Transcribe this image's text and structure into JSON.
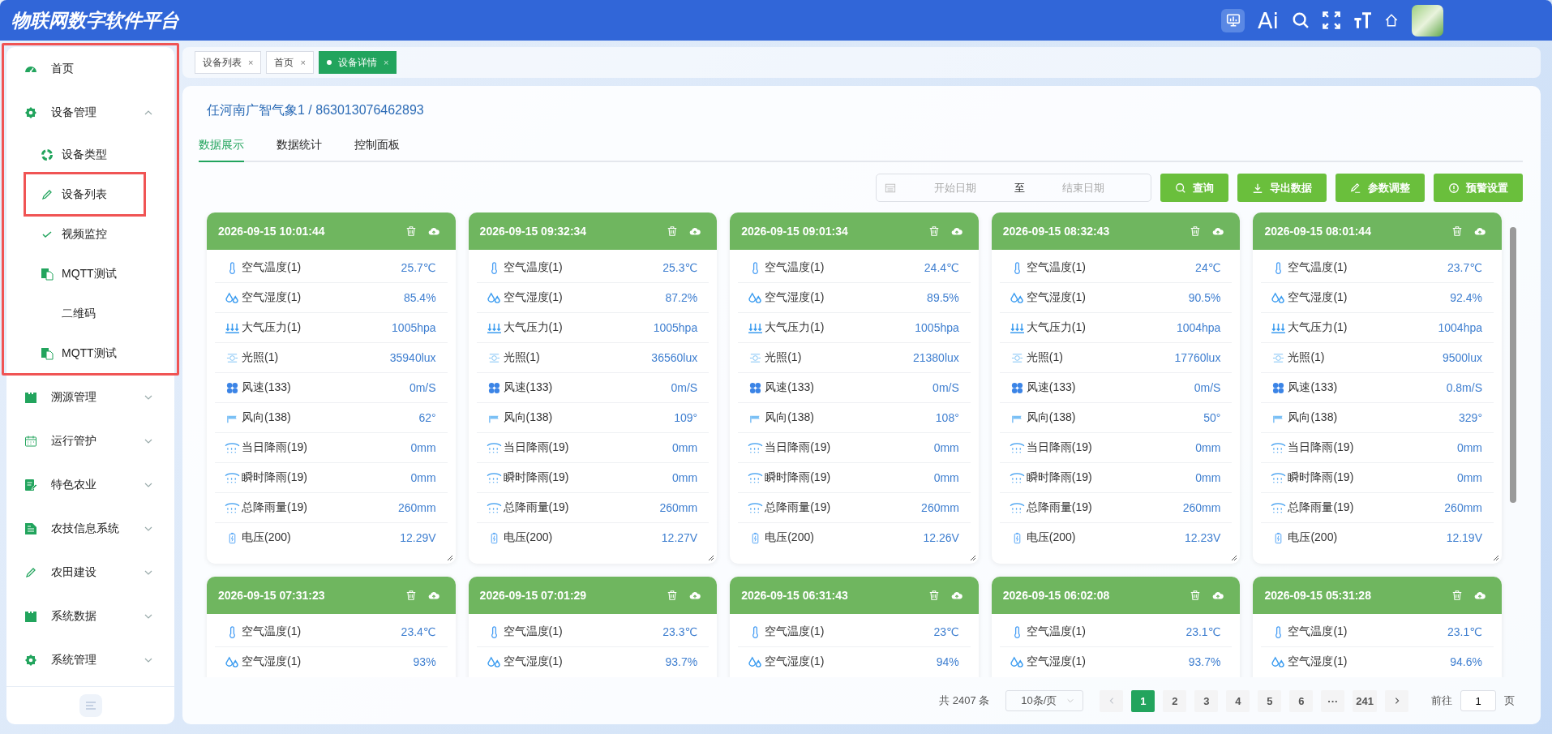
{
  "app": {
    "title": "物联网数字软件平台",
    "ai_label": "Ai"
  },
  "sidebar": {
    "sections": [
      {
        "outlined": true,
        "items": [
          {
            "kind": "gauge",
            "label": "首页",
            "has_children": false
          },
          {
            "kind": "gear",
            "label": "设备管理",
            "expanded": true,
            "has_children": true,
            "children": [
              {
                "kind": "ring",
                "label": "设备类型",
                "outlined": false
              },
              {
                "kind": "pencil",
                "label": "设备列表",
                "outlined": true
              },
              {
                "kind": "check",
                "label": "视频监控",
                "outlined": false
              },
              {
                "kind": "docs",
                "label": "MQTT测试",
                "outlined": false
              },
              {
                "kind": "none",
                "label": "二维码",
                "outlined": false
              },
              {
                "kind": "docs",
                "label": "MQTT测试",
                "outlined": false
              }
            ]
          }
        ]
      },
      {
        "items": [
          {
            "kind": "folder",
            "label": "溯源管理",
            "expanded": false,
            "has_children": true
          },
          {
            "kind": "calendar",
            "label": "运行管护",
            "expanded": false,
            "has_children": true
          },
          {
            "kind": "note",
            "label": "特色农业",
            "expanded": false,
            "has_children": true
          },
          {
            "kind": "doc",
            "label": "农技信息系统",
            "expanded": false,
            "has_children": true
          },
          {
            "kind": "pencil",
            "label": "农田建设",
            "expanded": false,
            "has_children": true
          },
          {
            "kind": "folder",
            "label": "系统数据",
            "expanded": false,
            "has_children": true
          },
          {
            "kind": "gear",
            "label": "系统管理",
            "expanded": false,
            "has_children": true
          }
        ]
      }
    ]
  },
  "tabs": [
    {
      "label": "设备列表",
      "selected": false,
      "close": "×"
    },
    {
      "label": "首页",
      "selected": false,
      "close": "×"
    },
    {
      "label": "设备详情",
      "selected": true,
      "close": "×"
    }
  ],
  "device": {
    "title": "任河南广智气象1 / 863013076462893"
  },
  "subtabs": [
    {
      "label": "数据展示",
      "selected": true
    },
    {
      "label": "数据统计",
      "selected": false
    },
    {
      "label": "控制面板",
      "selected": false
    }
  ],
  "filter": {
    "start_placeholder": "开始日期",
    "separator": "至",
    "end_placeholder": "结束日期"
  },
  "actions": [
    {
      "kind": "search",
      "label": "查询"
    },
    {
      "kind": "download",
      "label": "导出数据"
    },
    {
      "kind": "edit",
      "label": "参数调整"
    },
    {
      "kind": "alert",
      "label": "预警设置"
    }
  ],
  "records": [
    {
      "time": "2026-09-15 10:01:44",
      "readings": [
        {
          "kind": "temp",
          "label": "空气温度(1)",
          "value": "25.7℃"
        },
        {
          "kind": "humid",
          "label": "空气湿度(1)",
          "value": "85.4%"
        },
        {
          "kind": "pressure",
          "label": "大气压力(1)",
          "value": "1005hpa"
        },
        {
          "kind": "light",
          "label": "光照(1)",
          "value": "35940lux"
        },
        {
          "kind": "wind",
          "label": "风速(133)",
          "value": "0m/S"
        },
        {
          "kind": "flag",
          "label": "风向(138)",
          "value": "62°"
        },
        {
          "kind": "rain",
          "label": "当日降雨(19)",
          "value": "0mm"
        },
        {
          "kind": "rain",
          "label": "瞬时降雨(19)",
          "value": "0mm"
        },
        {
          "kind": "rain",
          "label": "总降雨量(19)",
          "value": "260mm"
        },
        {
          "kind": "battery",
          "label": "电压(200)",
          "value": "12.29V"
        }
      ]
    },
    {
      "time": "2026-09-15 09:32:34",
      "readings": [
        {
          "kind": "temp",
          "label": "空气温度(1)",
          "value": "25.3℃"
        },
        {
          "kind": "humid",
          "label": "空气湿度(1)",
          "value": "87.2%"
        },
        {
          "kind": "pressure",
          "label": "大气压力(1)",
          "value": "1005hpa"
        },
        {
          "kind": "light",
          "label": "光照(1)",
          "value": "36560lux"
        },
        {
          "kind": "wind",
          "label": "风速(133)",
          "value": "0m/S"
        },
        {
          "kind": "flag",
          "label": "风向(138)",
          "value": "109°"
        },
        {
          "kind": "rain",
          "label": "当日降雨(19)",
          "value": "0mm"
        },
        {
          "kind": "rain",
          "label": "瞬时降雨(19)",
          "value": "0mm"
        },
        {
          "kind": "rain",
          "label": "总降雨量(19)",
          "value": "260mm"
        },
        {
          "kind": "battery",
          "label": "电压(200)",
          "value": "12.27V"
        }
      ]
    },
    {
      "time": "2026-09-15 09:01:34",
      "readings": [
        {
          "kind": "temp",
          "label": "空气温度(1)",
          "value": "24.4℃"
        },
        {
          "kind": "humid",
          "label": "空气湿度(1)",
          "value": "89.5%"
        },
        {
          "kind": "pressure",
          "label": "大气压力(1)",
          "value": "1005hpa"
        },
        {
          "kind": "light",
          "label": "光照(1)",
          "value": "21380lux"
        },
        {
          "kind": "wind",
          "label": "风速(133)",
          "value": "0m/S"
        },
        {
          "kind": "flag",
          "label": "风向(138)",
          "value": "108°"
        },
        {
          "kind": "rain",
          "label": "当日降雨(19)",
          "value": "0mm"
        },
        {
          "kind": "rain",
          "label": "瞬时降雨(19)",
          "value": "0mm"
        },
        {
          "kind": "rain",
          "label": "总降雨量(19)",
          "value": "260mm"
        },
        {
          "kind": "battery",
          "label": "电压(200)",
          "value": "12.26V"
        }
      ]
    },
    {
      "time": "2026-09-15 08:32:43",
      "readings": [
        {
          "kind": "temp",
          "label": "空气温度(1)",
          "value": "24℃"
        },
        {
          "kind": "humid",
          "label": "空气湿度(1)",
          "value": "90.5%"
        },
        {
          "kind": "pressure",
          "label": "大气压力(1)",
          "value": "1004hpa"
        },
        {
          "kind": "light",
          "label": "光照(1)",
          "value": "17760lux"
        },
        {
          "kind": "wind",
          "label": "风速(133)",
          "value": "0m/S"
        },
        {
          "kind": "flag",
          "label": "风向(138)",
          "value": "50°"
        },
        {
          "kind": "rain",
          "label": "当日降雨(19)",
          "value": "0mm"
        },
        {
          "kind": "rain",
          "label": "瞬时降雨(19)",
          "value": "0mm"
        },
        {
          "kind": "rain",
          "label": "总降雨量(19)",
          "value": "260mm"
        },
        {
          "kind": "battery",
          "label": "电压(200)",
          "value": "12.23V"
        }
      ]
    },
    {
      "time": "2026-09-15 08:01:44",
      "readings": [
        {
          "kind": "temp",
          "label": "空气温度(1)",
          "value": "23.7℃"
        },
        {
          "kind": "humid",
          "label": "空气湿度(1)",
          "value": "92.4%"
        },
        {
          "kind": "pressure",
          "label": "大气压力(1)",
          "value": "1004hpa"
        },
        {
          "kind": "light",
          "label": "光照(1)",
          "value": "9500lux"
        },
        {
          "kind": "wind",
          "label": "风速(133)",
          "value": "0.8m/S"
        },
        {
          "kind": "flag",
          "label": "风向(138)",
          "value": "329°"
        },
        {
          "kind": "rain",
          "label": "当日降雨(19)",
          "value": "0mm"
        },
        {
          "kind": "rain",
          "label": "瞬时降雨(19)",
          "value": "0mm"
        },
        {
          "kind": "rain",
          "label": "总降雨量(19)",
          "value": "260mm"
        },
        {
          "kind": "battery",
          "label": "电压(200)",
          "value": "12.19V"
        }
      ]
    },
    {
      "time": "2026-09-15 07:31:23",
      "readings": [
        {
          "kind": "temp",
          "label": "空气温度(1)",
          "value": "23.4℃"
        },
        {
          "kind": "humid",
          "label": "空气湿度(1)",
          "value": "93%"
        }
      ]
    },
    {
      "time": "2026-09-15 07:01:29",
      "readings": [
        {
          "kind": "temp",
          "label": "空气温度(1)",
          "value": "23.3℃"
        },
        {
          "kind": "humid",
          "label": "空气湿度(1)",
          "value": "93.7%"
        }
      ]
    },
    {
      "time": "2026-09-15 06:31:43",
      "readings": [
        {
          "kind": "temp",
          "label": "空气温度(1)",
          "value": "23℃"
        },
        {
          "kind": "humid",
          "label": "空气湿度(1)",
          "value": "94%"
        }
      ]
    },
    {
      "time": "2026-09-15 06:02:08",
      "readings": [
        {
          "kind": "temp",
          "label": "空气温度(1)",
          "value": "23.1℃"
        },
        {
          "kind": "humid",
          "label": "空气湿度(1)",
          "value": "93.7%"
        }
      ]
    },
    {
      "time": "2026-09-15 05:31:28",
      "readings": [
        {
          "kind": "temp",
          "label": "空气温度(1)",
          "value": "23.1℃"
        },
        {
          "kind": "humid",
          "label": "空气湿度(1)",
          "value": "94.6%"
        }
      ]
    }
  ],
  "pagination": {
    "total": "共 2407 条",
    "page_size": "10条/页",
    "prev_disabled": true,
    "pages": [
      {
        "label": "1",
        "selected": true
      },
      {
        "label": "2",
        "selected": false
      },
      {
        "label": "3",
        "selected": false
      },
      {
        "label": "4",
        "selected": false
      },
      {
        "label": "5",
        "selected": false
      },
      {
        "label": "6",
        "selected": false
      },
      {
        "label": "···",
        "selected": false
      },
      {
        "label": "241",
        "selected": false
      }
    ],
    "goto_label": "前往",
    "goto_value": "1",
    "goto_suffix": "页"
  }
}
